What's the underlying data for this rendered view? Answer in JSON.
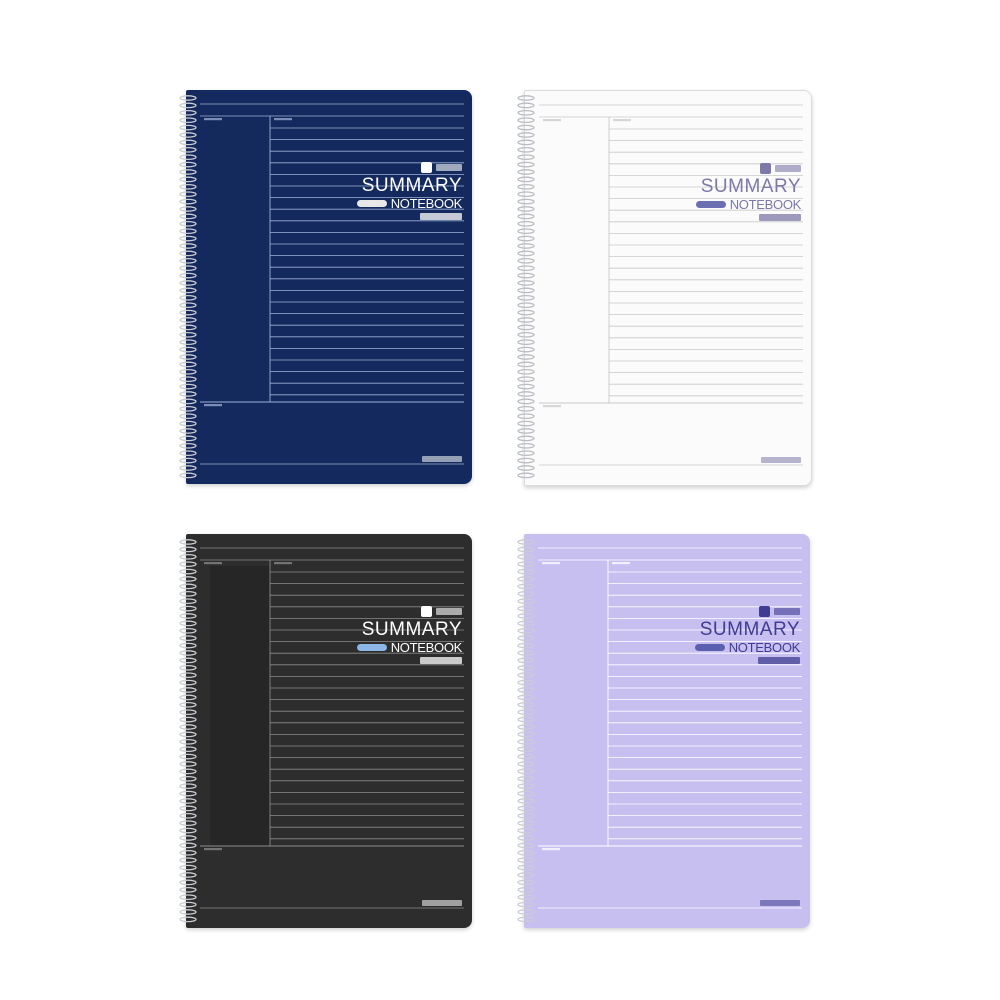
{
  "product": {
    "title_word": "SUMMARY",
    "subtitle_word": "NOTEBOOK"
  },
  "notebooks": [
    {
      "variant": "navy",
      "colors": {
        "cover": "#142a5e",
        "sidebar": "#14295c",
        "line": "#9fb0d6",
        "text": "#ffffff",
        "pill": "#e8e8e8",
        "spiral": "#c9ccd2"
      }
    },
    {
      "variant": "white",
      "colors": {
        "cover": "#fbfbfb",
        "sidebar": "#fbfbfb",
        "line": "#c9c9c9",
        "text": "#7c78a8",
        "pill": "#6a6fb2",
        "spiral": "#b9bcc1"
      }
    },
    {
      "variant": "charcoal",
      "colors": {
        "cover": "#2d2d2d",
        "sidebar": "#262626",
        "line": "#8b8b8b",
        "text": "#ffffff",
        "pill": "#8bb6e6",
        "spiral": "#c9ccd2"
      }
    },
    {
      "variant": "lavender",
      "colors": {
        "cover": "#c7bff0",
        "sidebar": "#c7bff0",
        "line": "#ffffff",
        "text": "#3f3c92",
        "pill": "#5b5fb0",
        "spiral": "#c9ccd2"
      }
    }
  ]
}
